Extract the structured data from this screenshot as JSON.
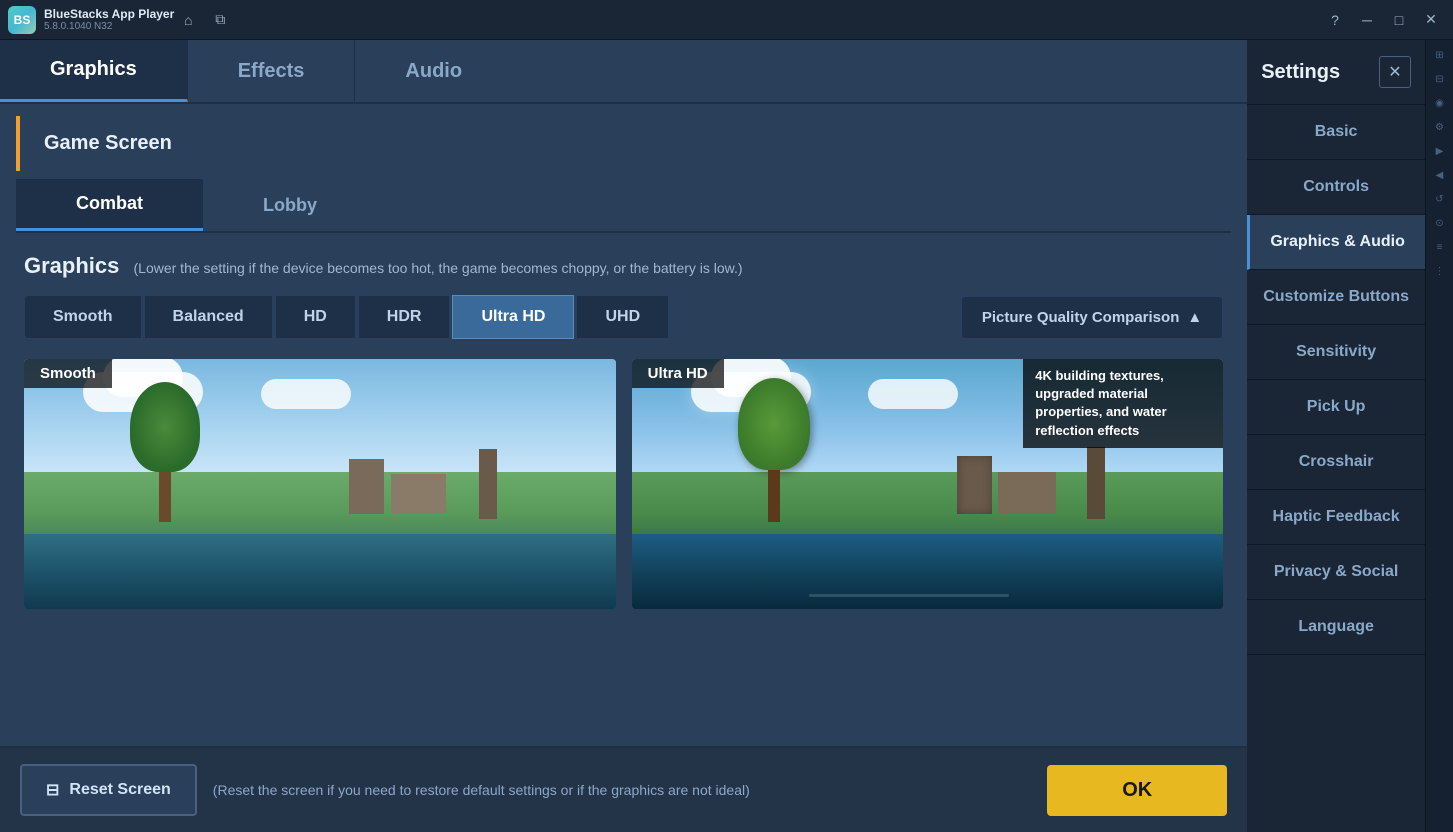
{
  "titleBar": {
    "appName": "BlueStacks App Player",
    "version": "5.8.0.1040  N32",
    "logoText": "BS"
  },
  "tabs": {
    "items": [
      {
        "label": "Graphics",
        "active": true
      },
      {
        "label": "Effects",
        "active": false
      },
      {
        "label": "Audio",
        "active": false
      }
    ]
  },
  "gameScreen": {
    "label": "Game Screen"
  },
  "subTabs": {
    "items": [
      {
        "label": "Combat",
        "active": true
      },
      {
        "label": "Lobby",
        "active": false
      }
    ]
  },
  "graphics": {
    "title": "Graphics",
    "subtitle": "(Lower the setting if the device becomes too hot, the game becomes choppy, or the battery is low.)",
    "qualityButtons": [
      {
        "label": "Smooth",
        "active": false
      },
      {
        "label": "Balanced",
        "active": false
      },
      {
        "label": "HD",
        "active": false
      },
      {
        "label": "HDR",
        "active": false
      },
      {
        "label": "Ultra HD",
        "active": true
      },
      {
        "label": "UHD",
        "active": false
      }
    ],
    "pictureQualityBtn": "Picture Quality Comparison",
    "comparison": {
      "left": {
        "label": "Smooth",
        "description": ""
      },
      "right": {
        "label": "Ultra HD",
        "description": "4K building textures, upgraded material properties, and water reflection effects"
      }
    }
  },
  "bottomBar": {
    "resetLabel": "Reset Screen",
    "resetNote": "(Reset the screen if you need to restore default settings or if the graphics are not ideal)",
    "okLabel": "OK"
  },
  "sidebar": {
    "title": "Settings",
    "closeIcon": "✕",
    "items": [
      {
        "label": "Basic",
        "active": false
      },
      {
        "label": "Controls",
        "active": false
      },
      {
        "label": "Graphics & Audio",
        "active": true
      },
      {
        "label": "Customize Buttons",
        "active": false
      },
      {
        "label": "Sensitivity",
        "active": false
      },
      {
        "label": "Pick Up",
        "active": false
      },
      {
        "label": "Crosshair",
        "active": false
      },
      {
        "label": "Haptic Feedback",
        "active": false
      },
      {
        "label": "Privacy & Social",
        "active": false
      },
      {
        "label": "Language",
        "active": false
      }
    ]
  },
  "sideIcons": [
    "⊞",
    "⊟",
    "◉",
    "⚙",
    "▶",
    "◀",
    "↺",
    "⊙",
    "≡",
    "⋮"
  ]
}
